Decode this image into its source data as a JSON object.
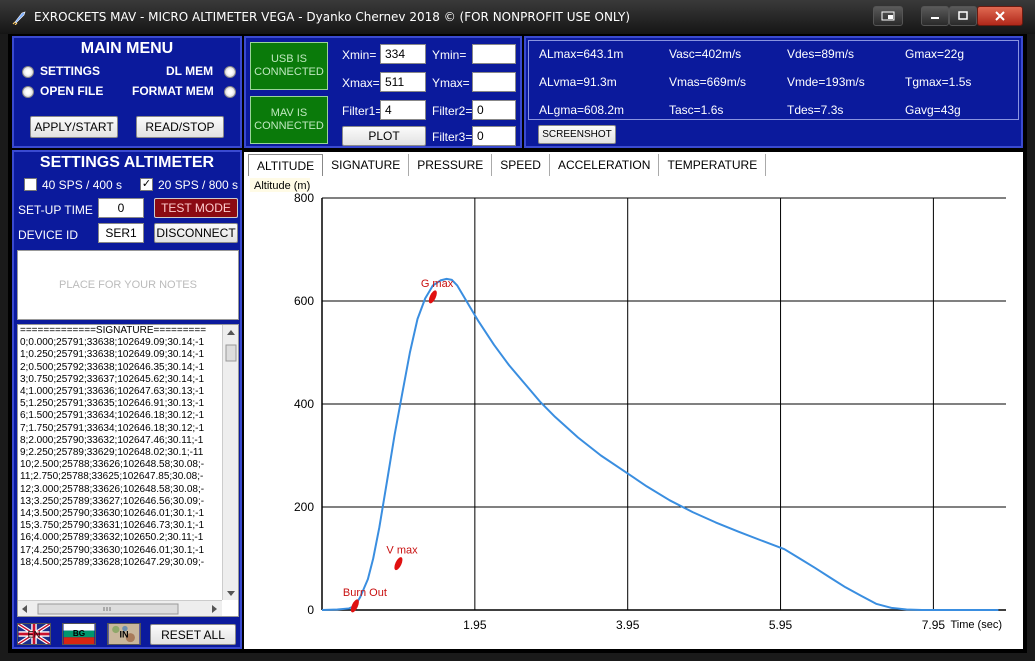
{
  "window": {
    "title": "EXROCKETS MAV - MICRO ALTIMETER VEGA - Dyanko Chernev 2018 © (FOR NONPROFIT USE ONLY)"
  },
  "main_menu": {
    "title": "MAIN MENU",
    "settings_label": "SETTINGS",
    "dl_mem_label": "DL MEM",
    "open_file_label": "OPEN FILE",
    "format_mem_label": "FORMAT MEM",
    "apply_start_label": "APPLY/START",
    "read_stop_label": "READ/STOP"
  },
  "status": {
    "usb_label": "USB IS CONNECTED",
    "mav_label": "MAV IS CONNECTED"
  },
  "plot_controls": {
    "xmin_label": "Xmin=",
    "xmin_value": "334",
    "ymin_label": "Ymin=",
    "ymin_value": "",
    "xmax_label": "Xmax=",
    "xmax_value": "511",
    "ymax_label": "Ymax=",
    "ymax_value": "",
    "filter1_label": "Filter1=",
    "filter1_value": "4",
    "filter2_label": "Filter2=",
    "filter2_value": "0",
    "filter3_label": "Filter3=",
    "filter3_value": "0",
    "plot_label": "PLOT"
  },
  "stats": {
    "almax": "ALmax=643.1m",
    "vasc": "Vasc=402m/s",
    "vdes": "Vdes=89m/s",
    "gmax": "Gmax=22g",
    "alvma": "ALvma=91.3m",
    "vmas": "Vmas=669m/s",
    "vmde": "Vmde=193m/s",
    "tgmax": "Tgmax=1.5s",
    "algma": "ALgma=608.2m",
    "tasc": "Tasc=1.6s",
    "tdes": "Tdes=7.3s",
    "gavg": "Gavg=43g",
    "screenshot_label": "SCREENSHOT"
  },
  "settings_altimeter": {
    "title": "SETTINGS ALTIMETER",
    "sps40_label": "40 SPS / 400 s",
    "sps40_checked": false,
    "sps20_label": "20 SPS / 800 s",
    "sps20_checked": true,
    "setup_time_label": "SET-UP TIME",
    "setup_time_value": "0",
    "test_mode_label": "TEST MODE",
    "device_id_label": "DEVICE ID",
    "device_id_value": "SER1",
    "disconnect_label": "DISCONNECT",
    "notes_placeholder": "PLACE FOR YOUR NOTES"
  },
  "signature_lines": [
    "=============SIGNATURE=========",
    "0;0.000;25791;33638;102649.09;30.14;-1",
    "1;0.250;25791;33638;102649.09;30.14;-1",
    "2;0.500;25792;33638;102646.35;30.14;-1",
    "3;0.750;25792;33637;102645.62;30.14;-1",
    "4;1.000;25791;33636;102647.63;30.13;-1",
    "5;1.250;25791;33635;102646.91;30.13;-1",
    "6;1.500;25791;33634;102646.18;30.12;-1",
    "7;1.750;25791;33634;102646.18;30.12;-1",
    "8;2.000;25790;33632;102647.46;30.11;-1",
    "9;2.250;25789;33629;102648.02;30.1;-11",
    "10;2.500;25788;33626;102648.58;30.08;-",
    "11;2.750;25788;33625;102647.85;30.08;-",
    "12;3.000;25788;33626;102648.58;30.08;-",
    "13;3.250;25789;33627;102646.56;30.09;-",
    "14;3.500;25790;33630;102646.01;30.1;-1",
    "15;3.750;25790;33631;102646.73;30.1;-1",
    "16;4.000;25789;33632;102650.2;30.11;-1",
    "17;4.250;25790;33630;102646.01;30.1;-1",
    "18;4.500;25789;33628;102647.29;30.09;-"
  ],
  "bottom": {
    "reset_all_label": "RESET ALL",
    "flag_en": "EN",
    "flag_bg": "BG",
    "flag_in": "IN"
  },
  "tabs": [
    "ALTITUDE",
    "SIGNATURE",
    "PRESSURE",
    "SPEED",
    "ACCELERATION",
    "TEMPERATURE"
  ],
  "chart_data": {
    "type": "line",
    "ylabel": "Altitude (m)",
    "xlabel": "Time (sec)",
    "xlim": [
      -0.05,
      8.9
    ],
    "ylim": [
      0,
      800
    ],
    "x_ticks": [
      "1.95",
      "3.95",
      "5.95",
      "7.95"
    ],
    "y_ticks": [
      "0",
      "200",
      "400",
      "600",
      "800"
    ],
    "grid": true,
    "series": [
      {
        "color": "#3a8ee0",
        "x": [
          -0.05,
          0.15,
          0.3,
          0.38,
          0.45,
          0.55,
          0.62,
          0.7,
          0.8,
          0.9,
          1.0,
          1.1,
          1.2,
          1.3,
          1.4,
          1.5,
          1.58,
          1.65,
          1.72,
          1.8,
          1.9,
          2.0,
          2.2,
          2.4,
          2.6,
          2.8,
          3.0,
          3.3,
          3.6,
          3.9,
          4.2,
          4.5,
          4.8,
          5.1,
          5.4,
          5.7,
          6.0,
          6.2,
          6.4,
          6.6,
          6.8,
          7.0,
          7.2,
          7.4,
          7.6,
          7.8,
          8.0,
          8.3,
          8.6,
          8.8
        ],
        "y": [
          0,
          1,
          3,
          8,
          25,
          60,
          100,
          160,
          250,
          340,
          420,
          500,
          565,
          605,
          630,
          640,
          643,
          641,
          630,
          610,
          585,
          560,
          515,
          475,
          440,
          405,
          375,
          335,
          300,
          270,
          240,
          213,
          190,
          170,
          152,
          135,
          118,
          100,
          82,
          63,
          44,
          28,
          12,
          4,
          1,
          0,
          0,
          0,
          0,
          0
        ]
      }
    ],
    "annotations": [
      {
        "label": "Burn Out",
        "x": 0.38,
        "y": 8
      },
      {
        "label": "V max",
        "x": 0.95,
        "y": 90
      },
      {
        "label": "G max",
        "x": 1.4,
        "y": 608
      }
    ]
  }
}
